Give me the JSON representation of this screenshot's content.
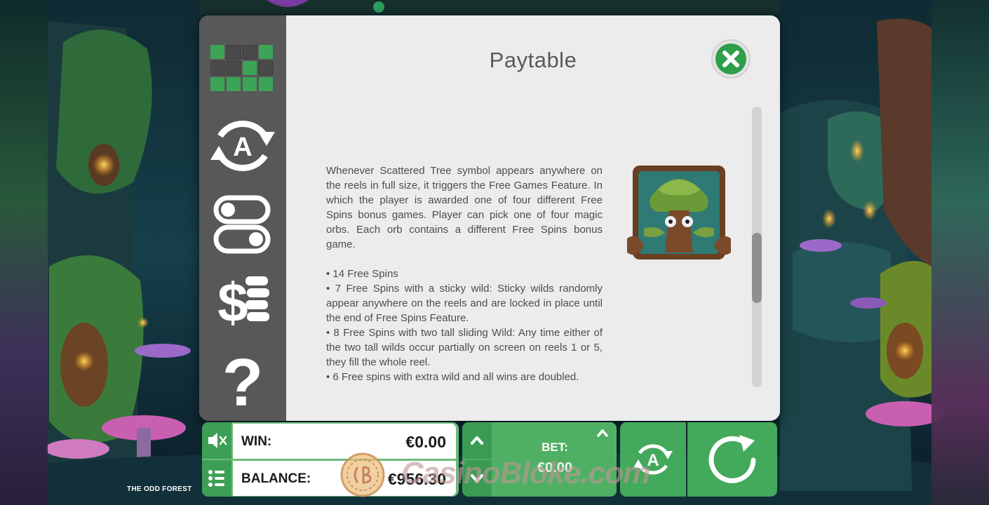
{
  "game": {
    "title": "THE ODD FOREST"
  },
  "paytable": {
    "title": "Paytable",
    "description_paragraph": "Whenever Scattered Tree symbol appears anywhere on the reels in full size, it triggers the Free Games Feature. In which the player is awarded one of four different Free Spins bonus games. Player can pick one of four magic orbs. Each orb contains a different Free Spins bonus game.",
    "bonus_list": [
      "• 14 Free Spins",
      "• 7 Free Spins with a sticky wild: Sticky wilds randomly appear anywhere on the reels and are locked in place until the end of Free Spins Feature.",
      "• 8 Free Spins with two tall sliding Wild: Any time either of the two tall wilds occur partially on screen on reels 1 or 5, they fill the whole reel.",
      "• 6 Free spins with extra wild and all wins are doubled."
    ],
    "scroll_position": 0.6
  },
  "sidebar": {
    "items": [
      {
        "name": "paylines",
        "icon": "grid-icon"
      },
      {
        "name": "autoplay-settings",
        "icon": "autoplay-icon"
      },
      {
        "name": "settings",
        "icon": "toggle-icon"
      },
      {
        "name": "paytable",
        "icon": "dollar-coins-icon"
      },
      {
        "name": "help",
        "icon": "question-icon"
      }
    ],
    "grid_pattern": [
      [
        1,
        0,
        0,
        1
      ],
      [
        0,
        0,
        1,
        0
      ],
      [
        1,
        1,
        1,
        1
      ]
    ]
  },
  "bottom_bar": {
    "win_label": "WIN:",
    "win_value": "€0.00",
    "balance_label": "BALANCE:",
    "balance_value": "€956.30",
    "bet_label": "BET:",
    "bet_value": "€0.00"
  },
  "watermark": {
    "text": "CasinoBloke.com"
  },
  "colors": {
    "accent_green": "#3da357",
    "panel_bg": "#ececec",
    "sidebar_bg": "#585858",
    "text_gray": "#4d4d4d"
  }
}
